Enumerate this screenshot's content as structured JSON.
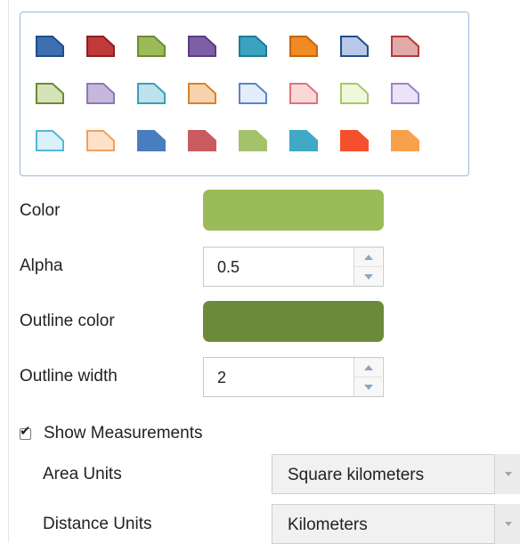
{
  "symbol_picker": {
    "rows": [
      [
        {
          "icon": "pennant-icon",
          "fill": "#3E6FB0",
          "stroke": "#1F4E8C"
        },
        {
          "icon": "pennant-icon",
          "fill": "#C0393B",
          "stroke": "#8E1F21"
        },
        {
          "icon": "pennant-icon",
          "fill": "#9BBB59",
          "stroke": "#6D8A33"
        },
        {
          "icon": "pennant-icon",
          "fill": "#7E5EA5",
          "stroke": "#5A3E80"
        },
        {
          "icon": "pennant-icon",
          "fill": "#39A3C1",
          "stroke": "#1C7A95"
        },
        {
          "icon": "pennant-icon",
          "fill": "#F08A24",
          "stroke": "#C2650C"
        },
        {
          "icon": "pennant-icon",
          "fill": "#B7C9E6",
          "stroke": "#1F4E8C"
        },
        {
          "icon": "pennant-icon",
          "fill": "#E3A8A8",
          "stroke": "#B03A3A"
        }
      ],
      [
        {
          "icon": "pennant-icon",
          "fill": "#D5E3B8",
          "stroke": "#6D8A33"
        },
        {
          "icon": "pennant-icon",
          "fill": "#C6B7DC",
          "stroke": "#8D79B1"
        },
        {
          "icon": "pennant-icon",
          "fill": "#BEE1EB",
          "stroke": "#3C9FBA"
        },
        {
          "icon": "pennant-icon",
          "fill": "#F8D2AE",
          "stroke": "#D9822B"
        },
        {
          "icon": "pennant-icon",
          "fill": "#E4EDFB",
          "stroke": "#5A85C7"
        },
        {
          "icon": "pennant-icon",
          "fill": "#FAD8D8",
          "stroke": "#E0737A"
        },
        {
          "icon": "pennant-icon",
          "fill": "#F0F8DC",
          "stroke": "#A9C76A"
        },
        {
          "icon": "pennant-icon",
          "fill": "#EBE3F6",
          "stroke": "#9B84C9"
        }
      ],
      [
        {
          "icon": "pennant-icon",
          "fill": "#D9F1F8",
          "stroke": "#56B7D6"
        },
        {
          "icon": "pennant-icon",
          "fill": "#FDE2CA",
          "stroke": "#F2A05E"
        },
        {
          "icon": "pennant-icon",
          "fill": "#4A7CC0",
          "stroke": "#4A7CC0"
        },
        {
          "icon": "pennant-icon",
          "fill": "#C95A5E",
          "stroke": "#C95A5E"
        },
        {
          "icon": "pennant-icon",
          "fill": "#A4C26B",
          "stroke": "#A4C26B"
        },
        {
          "icon": "pennant-icon",
          "fill": "#41A8C6",
          "stroke": "#41A8C6"
        },
        {
          "icon": "pennant-icon",
          "fill": "#F5502E",
          "stroke": "#F5502E"
        },
        {
          "icon": "pennant-icon",
          "fill": "#F9A04C",
          "stroke": "#F9A04C"
        }
      ],
      [
        {
          "icon": "pennant-icon",
          "fill": "#3E6FB0",
          "stroke": "#3E6FB0"
        },
        {
          "icon": "pennant-icon",
          "fill": "#C0393B",
          "stroke": "#C0393B"
        },
        {
          "icon": "pennant-icon",
          "fill": "#9BBB59",
          "stroke": "#9BBB59"
        },
        {
          "icon": "pennant-icon",
          "fill": "#39A3C1",
          "stroke": "#39A3C1"
        },
        {
          "icon": "pennant-icon",
          "fill": "#F5502E",
          "stroke": "#F5502E"
        },
        {
          "icon": "pennant-icon",
          "fill": "#7E5EA5",
          "stroke": "#7E5EA5"
        },
        {
          "icon": "pennant-icon",
          "fill": "#39A3C1",
          "stroke": "#39A3C1"
        },
        {
          "icon": "pennant-icon",
          "fill": "#C0393B",
          "stroke": "#C0393B"
        }
      ]
    ]
  },
  "color": {
    "label": "Color",
    "value": "#9BBB59"
  },
  "alpha": {
    "label": "Alpha",
    "value": "0.5"
  },
  "outline_color": {
    "label": "Outline color",
    "value": "#6D8A3A"
  },
  "outline_width": {
    "label": "Outline width",
    "value": "2"
  },
  "show_measurements": {
    "label": "Show Measurements",
    "checked": true
  },
  "area_units": {
    "label": "Area Units",
    "value": "Square kilometers"
  },
  "distance_units": {
    "label": "Distance Units",
    "value": "Kilometers"
  }
}
